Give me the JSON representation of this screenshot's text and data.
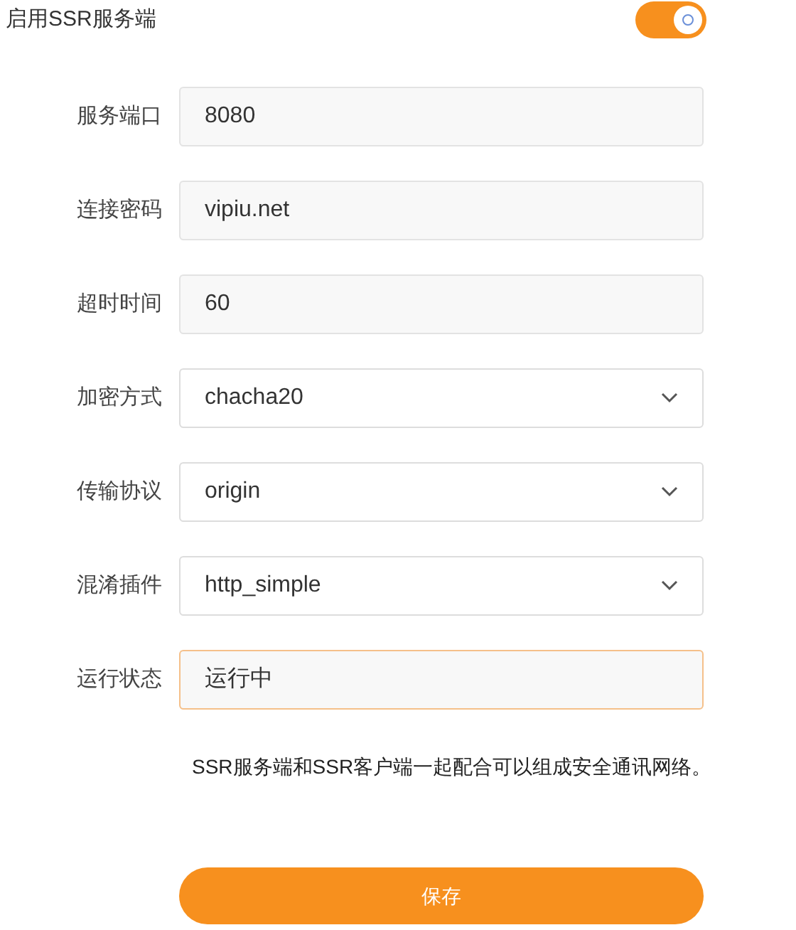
{
  "enable": {
    "label": "启用SSR服务端",
    "on": true
  },
  "fields": [
    {
      "label": "服务端口",
      "kind": "input",
      "value": "8080"
    },
    {
      "label": "连接密码",
      "kind": "input",
      "value": "vipiu.net"
    },
    {
      "label": "超时时间",
      "kind": "input",
      "value": "60"
    },
    {
      "label": "加密方式",
      "kind": "select",
      "value": "chacha20"
    },
    {
      "label": "传输协议",
      "kind": "select",
      "value": "origin"
    },
    {
      "label": "混淆插件",
      "kind": "select",
      "value": "http_simple"
    },
    {
      "label": "运行状态",
      "kind": "status",
      "value": "运行中"
    }
  ],
  "note": "SSR服务端和SSR客户端一起配合可以组成安全通讯网络。",
  "save_button": "保存"
}
